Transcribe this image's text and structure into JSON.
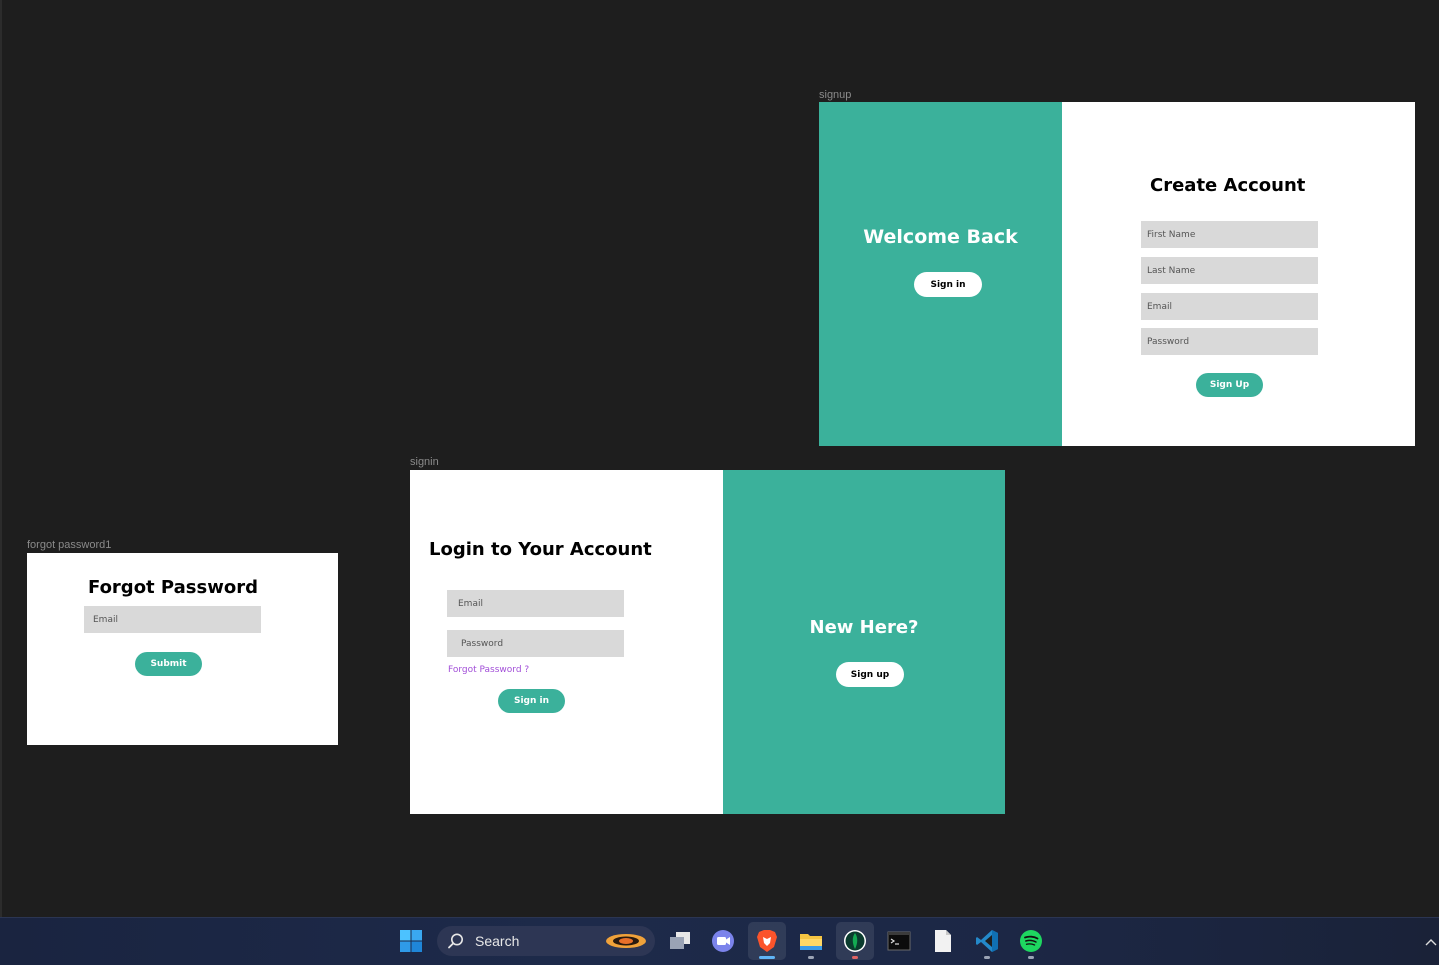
{
  "frames": {
    "signup": {
      "label": "signup",
      "welcome_title": "Welcome Back",
      "welcome_button": "Sign in",
      "title": "Create Account",
      "fields": [
        "First Name",
        "Last Name",
        "Email",
        "Password"
      ],
      "submit": "Sign Up"
    },
    "signin": {
      "label": "signin",
      "title": "Login to Your Account",
      "fields": [
        "Email",
        "Password"
      ],
      "forgot_link": "Forgot Password ?",
      "submit": "Sign in",
      "side_title": "New Here?",
      "side_button": "Sign up"
    },
    "forgot": {
      "label": "forgot password1",
      "title": "Forgot Password",
      "fields": [
        "Email"
      ],
      "submit": "Submit"
    }
  },
  "colors": {
    "accent": "#3bb19b",
    "canvas": "#1e1e1e",
    "field": "#d9d9d9",
    "link": "#a24fd8"
  },
  "taskbar": {
    "search_label": "Search",
    "apps": [
      "windows-start",
      "task-view",
      "teams-chat",
      "brave-browser",
      "file-explorer",
      "mongodb-compass",
      "terminal",
      "notepad",
      "vscode",
      "spotify"
    ]
  }
}
